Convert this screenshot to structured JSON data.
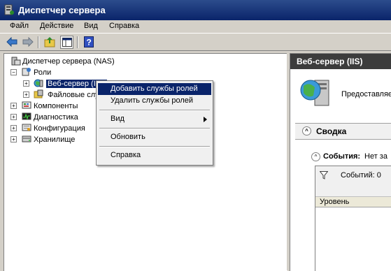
{
  "window": {
    "title": "Диспетчер сервера"
  },
  "menu": {
    "file": "Файл",
    "action": "Действие",
    "view": "Вид",
    "help": "Справка"
  },
  "toolbar": {
    "back": "back-arrow",
    "forward": "forward-arrow",
    "up": "up-folder",
    "show_hide": "show-hide-tree",
    "help": "help"
  },
  "tree": {
    "root": "Диспетчер сервера (NAS)",
    "roles": "Роли",
    "web_server": "Веб-сервер (IIS)",
    "file_services": "Файловые службы",
    "components": "Компоненты",
    "diagnostics": "Диагностика",
    "configuration": "Конфигурация",
    "storage": "Хранилище"
  },
  "context_menu": {
    "add_role_services": "Добавить службы ролей",
    "remove_role_services": "Удалить службы ролей",
    "view": "Вид",
    "refresh": "Обновить",
    "help": "Справка"
  },
  "right_panel": {
    "header": "Веб-сервер (IIS)",
    "description": "Предоставляет",
    "summary": "Сводка",
    "events_label": "События:",
    "events_value": "Нет за",
    "events_count": "Событий: 0",
    "column_level": "Уровень"
  },
  "colors": {
    "title_bar": "#0a246a",
    "selection": "#0a246a",
    "header_dark": "#3c3c3c",
    "chrome": "#d4d0c8"
  }
}
